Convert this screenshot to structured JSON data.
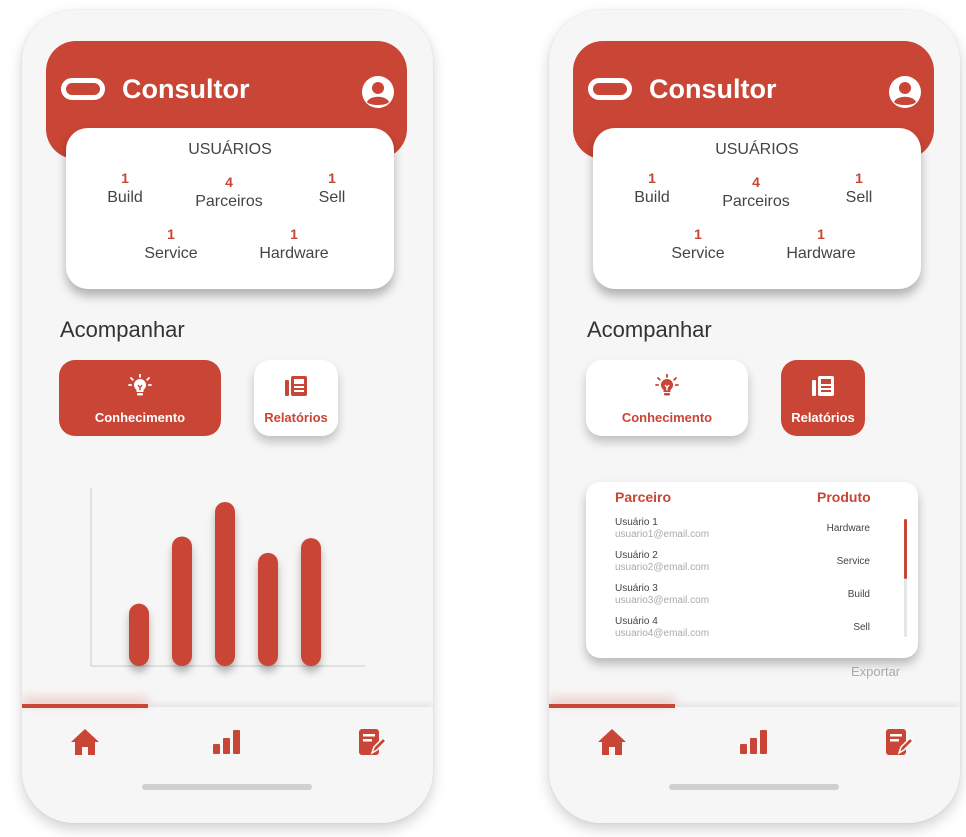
{
  "colors": {
    "brand": "#c94535",
    "background": "#f6f6f6",
    "card": "#ffffff",
    "muted": "#aaaaaa"
  },
  "screens": [
    {
      "app_title": "Consultor",
      "stats": {
        "title": "USUÁRIOS",
        "items": [
          {
            "value": "1",
            "label": "Build"
          },
          {
            "value": "4",
            "label": "Parceiros"
          },
          {
            "value": "1",
            "label": "Sell"
          },
          {
            "value": "1",
            "label": "Service"
          },
          {
            "value": "1",
            "label": "Hardware"
          }
        ]
      },
      "section_title": "Acompanhar",
      "buttons": [
        {
          "label": "Conhecimento",
          "icon": "lightbulb-icon",
          "active": true
        },
        {
          "label": "Relatórios",
          "icon": "report-icon",
          "active": false
        }
      ],
      "chart_data": {
        "type": "bar",
        "categories": [
          "",
          "",
          "",
          "",
          ""
        ],
        "values": [
          38,
          79,
          100,
          69,
          78
        ],
        "ylim": [
          0,
          100
        ],
        "grid": false
      },
      "nav": [
        "home-icon",
        "bar-chart-icon",
        "edit-note-icon"
      ]
    },
    {
      "app_title": "Consultor",
      "stats": {
        "title": "USUÁRIOS",
        "items": [
          {
            "value": "1",
            "label": "Build"
          },
          {
            "value": "4",
            "label": "Parceiros"
          },
          {
            "value": "1",
            "label": "Sell"
          },
          {
            "value": "1",
            "label": "Service"
          },
          {
            "value": "1",
            "label": "Hardware"
          }
        ]
      },
      "section_title": "Acompanhar",
      "buttons": [
        {
          "label": "Conhecimento",
          "icon": "lightbulb-icon",
          "active": false
        },
        {
          "label": "Relatórios",
          "icon": "report-icon",
          "active": true
        }
      ],
      "table": {
        "headers": [
          "Parceiro",
          "Produto"
        ],
        "rows": [
          {
            "name": "Usuário 1",
            "email": "usuario1@email.com",
            "product": "Hardware"
          },
          {
            "name": "Usuário 2",
            "email": "usuario2@email.com",
            "product": "Service"
          },
          {
            "name": "Usuário 3",
            "email": "usuario3@email.com",
            "product": "Build"
          },
          {
            "name": "Usuário 4",
            "email": "usuario4@email.com",
            "product": "Sell"
          }
        ],
        "export_label": "Exportar"
      },
      "nav": [
        "home-icon",
        "bar-chart-icon",
        "edit-note-icon"
      ]
    }
  ]
}
